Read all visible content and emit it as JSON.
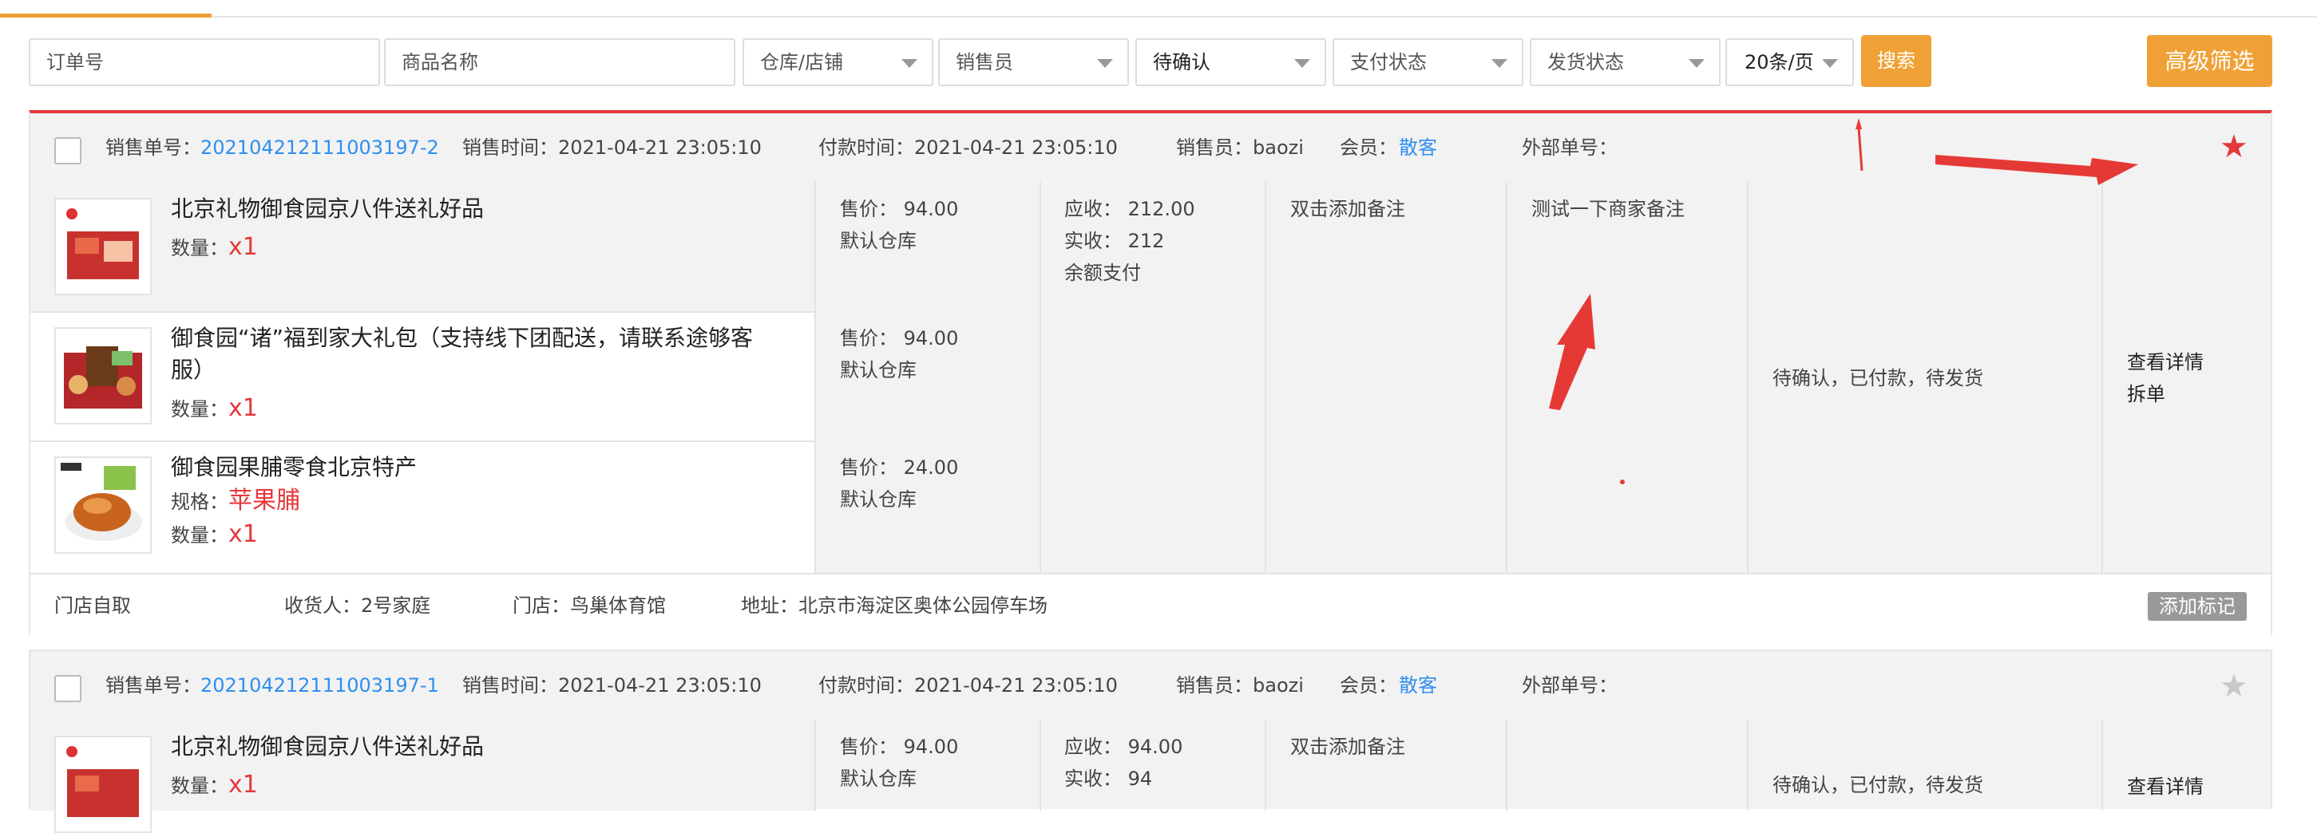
{
  "filters": {
    "order_no_placeholder": "订单号",
    "product_name_placeholder": "商品名称",
    "warehouse": "仓库/店铺",
    "salesperson": "销售员",
    "status": "待确认",
    "pay_status": "支付状态",
    "ship_status": "发货状态",
    "page_size": "20条/页",
    "search_label": "搜索",
    "advanced_label": "高级筛选"
  },
  "orders": [
    {
      "order_no_label": "销售单号：",
      "order_no": "202104212111003197-2",
      "sale_time": "销售时间：2021-04-21 23:05:10",
      "pay_time": "付款时间：2021-04-21 23:05:10",
      "salesperson": "销售员：baozi",
      "member_label": "会员：",
      "member": "散客",
      "external": "外部单号：",
      "starred": true,
      "items": [
        {
          "name": "北京礼物御食园京八件送礼好品",
          "qty_label": "数量：",
          "qty": "x1",
          "price": "售价：  94.00",
          "warehouse": "默认仓库"
        },
        {
          "name": "御食园“诸”福到家大礼包（支持线下团配送，请联系途够客服）",
          "qty_label": "数量：",
          "qty": "x1",
          "price": "售价：  94.00",
          "warehouse": "默认仓库"
        },
        {
          "name": "御食园果脯零食北京特产",
          "spec_label": "规格：",
          "spec": "苹果脯",
          "qty_label": "数量：",
          "qty": "x1",
          "price": "售价：  24.00",
          "warehouse": "默认仓库"
        }
      ],
      "receivable": "应收：  212.00",
      "received": "实收：  212",
      "pay_method": "余额支付",
      "buyer_note": "双击添加备注",
      "merchant_note": "测试一下商家备注",
      "status_text": "待确认，已付款，待发货",
      "view_detail": "查看详情",
      "split": "拆单",
      "footer": {
        "delivery": "门店自取",
        "receiver": "收货人：2号家庭",
        "store": "门店：鸟巢体育馆",
        "address": "地址：北京市海淀区奥体公园停车场",
        "tag_button": "添加标记"
      }
    },
    {
      "order_no_label": "销售单号：",
      "order_no": "202104212111003197-1",
      "sale_time": "销售时间：2021-04-21 23:05:10",
      "pay_time": "付款时间：2021-04-21 23:05:10",
      "salesperson": "销售员：baozi",
      "member_label": "会员：",
      "member": "散客",
      "external": "外部单号：",
      "starred": false,
      "items": [
        {
          "name": "北京礼物御食园京八件送礼好品",
          "qty_label": "数量：",
          "qty": "x1",
          "price": "售价：  94.00",
          "warehouse": "默认仓库"
        }
      ],
      "receivable": "应收：  94.00",
      "received": "实收：  94",
      "buyer_note": "双击添加备注",
      "status_text": "待确认，已付款，待发货",
      "view_detail": "查看详情"
    }
  ],
  "colors": {
    "accent": "#f0a135",
    "link": "#2f8ff0",
    "red": "#e4393c",
    "star_active": "#e4393c",
    "star_inactive": "#c8c8c8"
  }
}
